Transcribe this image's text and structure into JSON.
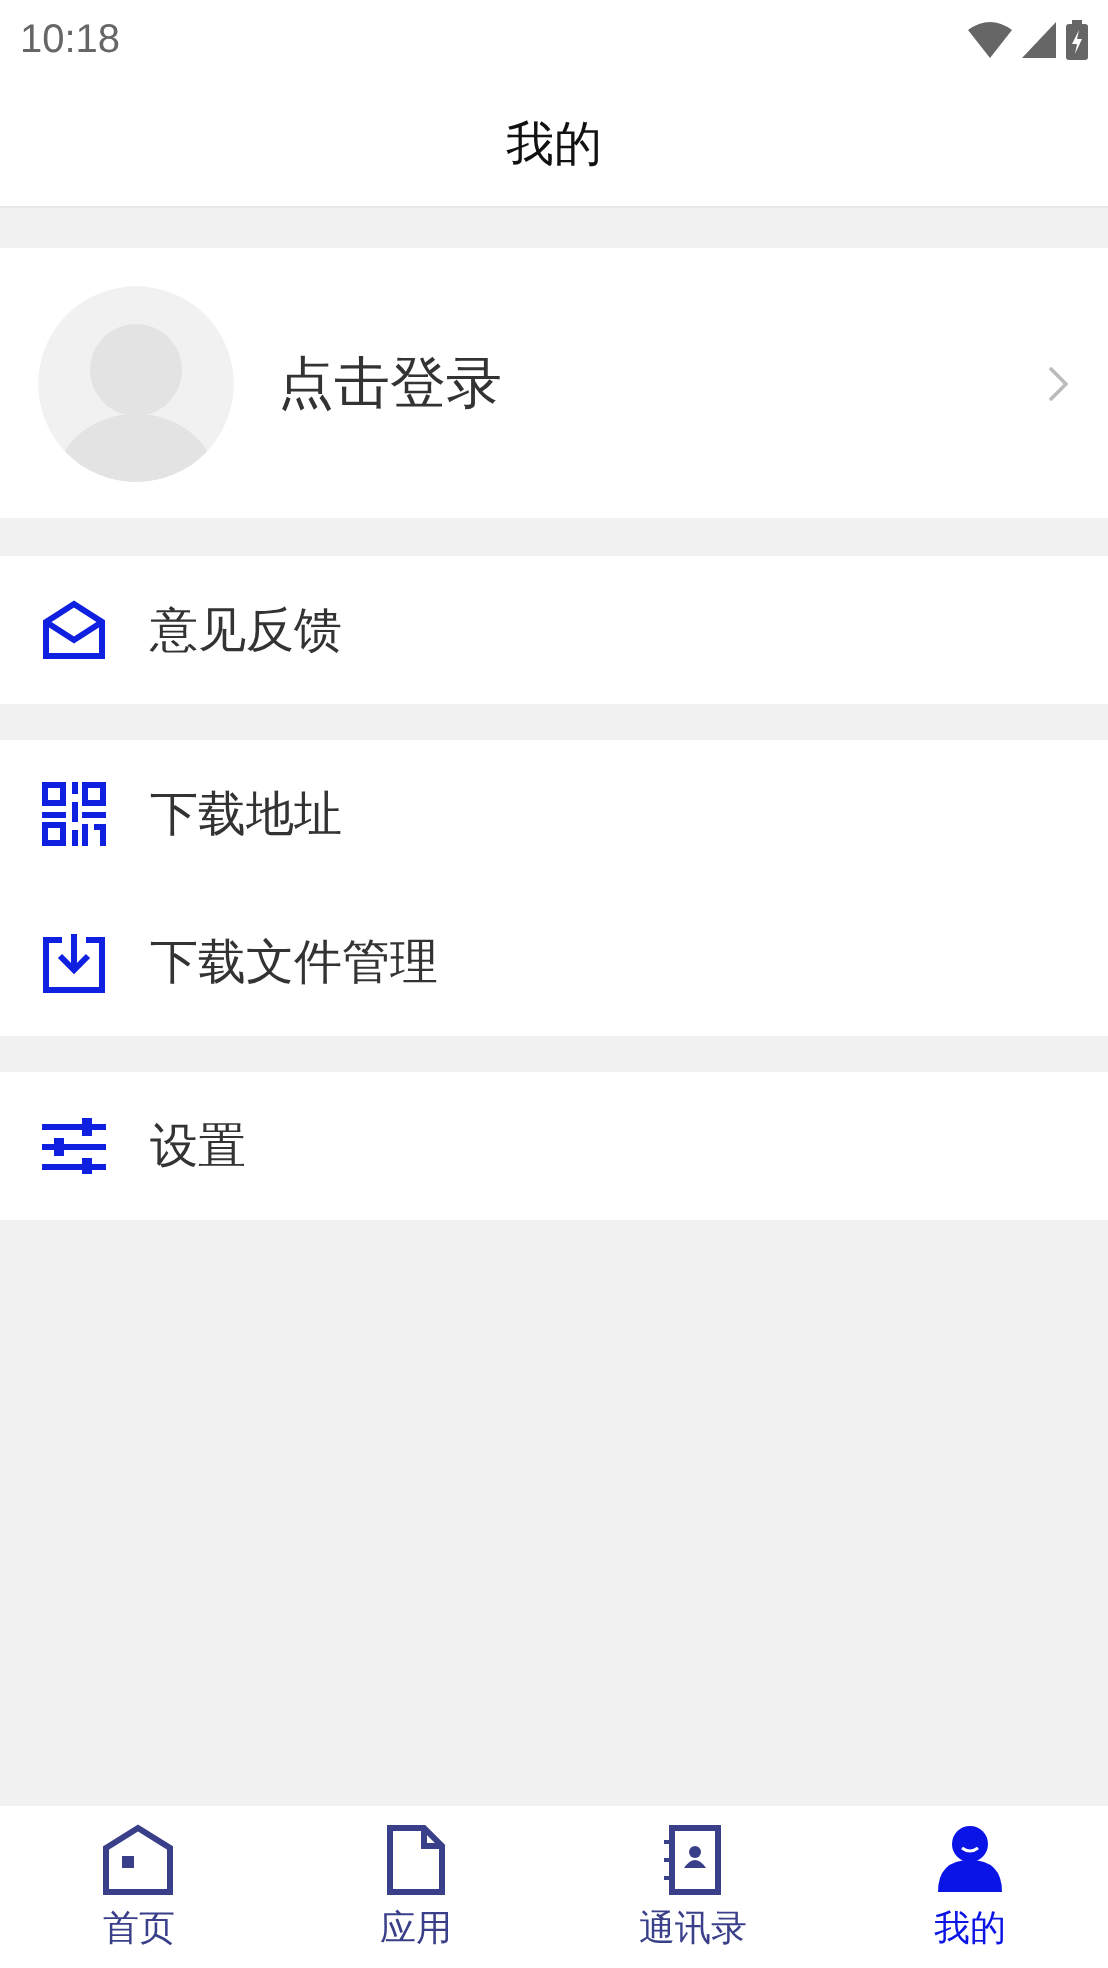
{
  "status_bar": {
    "time": "10:18"
  },
  "header": {
    "title": "我的"
  },
  "profile": {
    "login_text": "点击登录"
  },
  "menu_groups": [
    {
      "items": [
        {
          "kind": "mail",
          "label": "意见反馈"
        }
      ]
    },
    {
      "items": [
        {
          "kind": "qr",
          "label": "下载地址"
        },
        {
          "kind": "download",
          "label": "下载文件管理"
        }
      ]
    },
    {
      "items": [
        {
          "kind": "settings",
          "label": "设置"
        }
      ]
    }
  ],
  "tabs": [
    {
      "kind": "home",
      "label": "首页",
      "selected": false
    },
    {
      "kind": "apps",
      "label": "应用",
      "selected": false
    },
    {
      "kind": "contacts",
      "label": "通讯录",
      "selected": false
    },
    {
      "kind": "me",
      "label": "我的",
      "selected": true
    }
  ]
}
